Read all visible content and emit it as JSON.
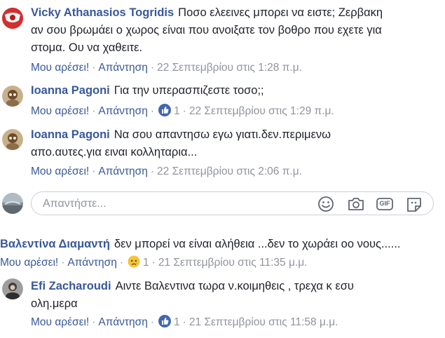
{
  "comments": [
    {
      "author": "Vicky Athanasios Togridis",
      "line1": "Ποσο ελεεινες μπορει να ειστε; Ζερβακη",
      "line2": "αν σου βρωμάει ο χωρος είναι που ανοιξατε τον βοθρο που εχετε για",
      "line3": "στομα. Ου να χαθειτε.",
      "like": "Μου αρέσει!",
      "reply": "Απάντηση",
      "time": "22 Σεπτεμβρίου στις 1:28 π.μ."
    },
    {
      "author": "Ioanna Pagoni",
      "line1": "Για την υπερασπιζεστε τοσο;;",
      "like": "Μου αρέσει!",
      "reply": "Απάντηση",
      "reaction_count": "1",
      "time": "22 Σεπτεμβρίου στις 1:29 π.μ."
    },
    {
      "author": "Ioanna Pagoni",
      "line1": "Να σου απαντησω εγω γιατι.δεν.περιμενω",
      "line2": "απο.αυτες.για ειναι κολληταρια...",
      "like": "Μου αρέσει!",
      "reply": "Απάντηση",
      "time": "22 Σεπτεμβρίου στις 2:06 π.μ."
    }
  ],
  "reply_box": {
    "placeholder": "Απαντήστε...",
    "icons": [
      "emoji-icon",
      "camera-icon",
      "gif-icon",
      "sticker-icon"
    ],
    "gif_label": "GIF"
  },
  "top_comment": {
    "author": "Βαλεντίνα Διαμαντή",
    "text": "δεν μπορεί να είναι αλήθεια ...δεν το χωράει οο νους......",
    "like": "Μου αρέσει!",
    "reply": "Απάντηση",
    "reaction_count": "1",
    "time": "21 Σεπτεμβρίου στις 11:35 μ.μ."
  },
  "reply_comment": {
    "author": "Efi Zacharoudi",
    "line1": "Αιντε Βαλεντινα τωρα ν.κοιμηθεις , τρεχα κ εσυ",
    "line2": "ολη.μερα",
    "like": "Μου αρέσει!",
    "reply": "Απάντηση",
    "reaction_count": "1",
    "time": "21 Σεπτεμβρίου στις 11:58 μ.μ."
  },
  "colors": {
    "link": "#385898",
    "meta": "#90949c",
    "like_blue": "#4267b2",
    "sad_yellow": "#f7c33a"
  }
}
